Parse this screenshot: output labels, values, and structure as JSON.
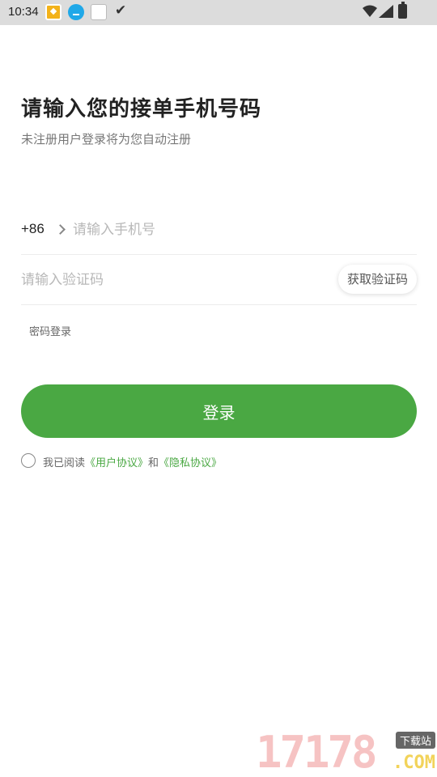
{
  "status_bar": {
    "time": "10:34",
    "icons": [
      "app-notification-icon",
      "download-icon",
      "app-notification-icon",
      "check-icon",
      "wifi-icon",
      "signal-icon",
      "battery-icon"
    ]
  },
  "header": {
    "title": "请输入您的接单手机号码",
    "subtitle": "未注册用户登录将为您自动注册"
  },
  "form": {
    "country_code": "+86",
    "phone_placeholder": "请输入手机号",
    "code_placeholder": "请输入验证码",
    "get_code_label": "获取验证码",
    "password_login_label": "密码登录",
    "login_label": "登录"
  },
  "agreement": {
    "prefix": "我已阅读",
    "user_agreement": "《用户协议》",
    "conjunction": "和",
    "privacy_agreement": "《隐私协议》"
  },
  "watermark": {
    "digits": "17178",
    "badge": "下载站",
    "suffix": ".COM"
  },
  "colors": {
    "accent": "#4aa843",
    "status_bar": "#dcdcdc",
    "placeholder": "#b8b8b8"
  }
}
